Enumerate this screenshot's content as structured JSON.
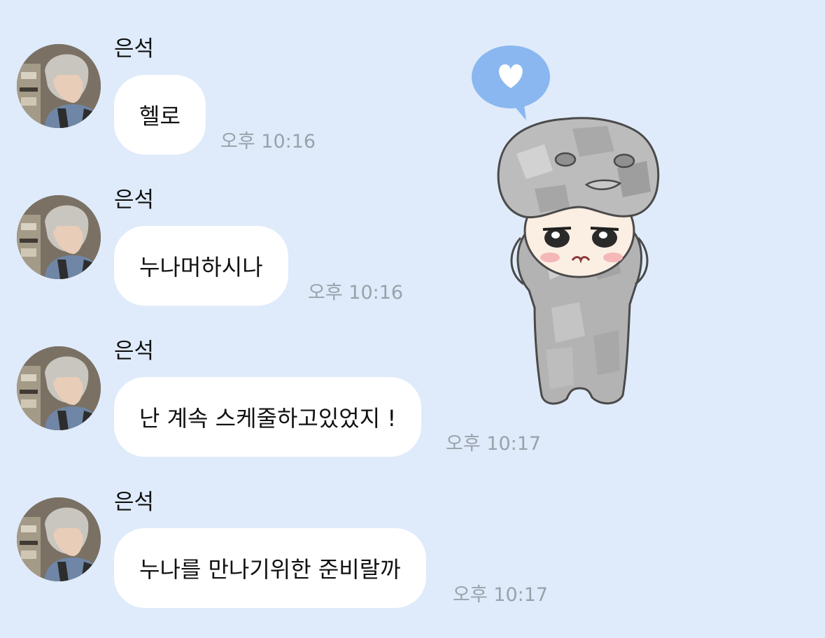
{
  "messages": [
    {
      "sender": "은석",
      "text": "헬로",
      "time": "오후 10:16"
    },
    {
      "sender": "은석",
      "text": "누나머하시나",
      "time": "오후 10:16"
    },
    {
      "sender": "은석",
      "text": "난 계속 스케줄하고있었지 !",
      "time": "오후 10:17"
    },
    {
      "sender": "은석",
      "text": "누나를 만나기위한 준비랄까",
      "time": "오후 10:17"
    }
  ],
  "sticker": {
    "icon": "heart-speech-bubble-icon"
  },
  "colors": {
    "background": "#dfebfa",
    "bubble": "#ffffff",
    "time_text": "#9aa1ab",
    "heart_bubble": "#8ab7f0"
  }
}
